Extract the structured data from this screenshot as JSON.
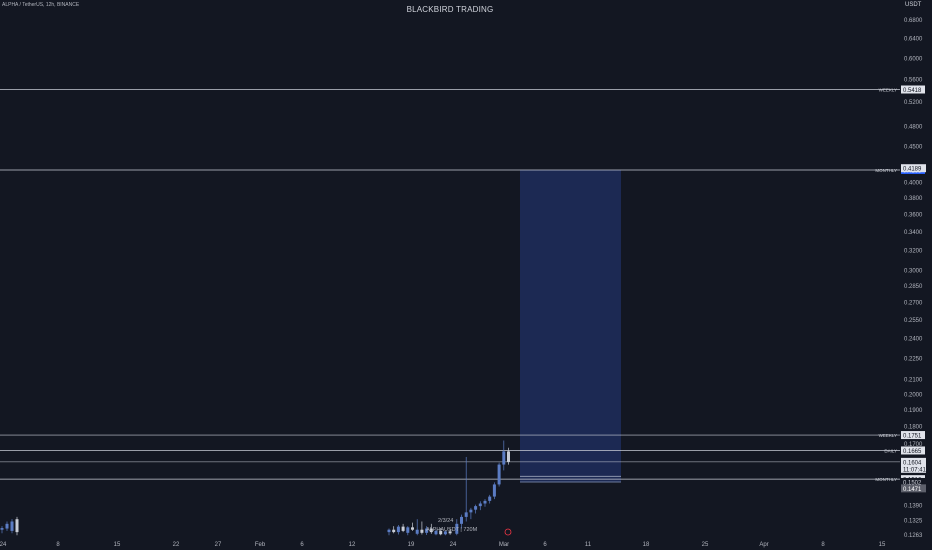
{
  "header": {
    "symbol_info": "ALPHA / TetherUS, 12h, BINANCE",
    "title": "BLACKBIRD TRADING",
    "currency": "USDT"
  },
  "colors": {
    "background": "#131722",
    "grid": "#1e222d",
    "level_line": "#c8ccd6",
    "target_box": "#1e2d5c",
    "candle_up": "#5b7cc4",
    "candle_down": "#c9cdd6"
  },
  "chart_data": {
    "type": "candlestick",
    "price_scale": "log",
    "y_axis_ticks": [
      "0.6800",
      "0.6400",
      "0.6000",
      "0.5600",
      "0.5200",
      "0.4800",
      "0.4500",
      "0.4000",
      "0.3800",
      "0.3600",
      "0.3400",
      "0.3200",
      "0.3000",
      "0.2850",
      "0.2700",
      "0.2550",
      "0.2400",
      "0.2250",
      "0.2100",
      "0.2000",
      "0.1900",
      "0.1800",
      "0.1700",
      "0.1390",
      "0.1325",
      "0.1263"
    ],
    "x_axis_ticks": [
      "24",
      "8",
      "15",
      "22",
      "27",
      "Feb",
      "6",
      "12",
      "19",
      "24",
      "Mar",
      "6",
      "11",
      "18",
      "25",
      "Apr",
      "8",
      "15"
    ],
    "levels": [
      {
        "label": "WEEKLY",
        "price": "0.5418",
        "value": 0.5418,
        "badge": "light"
      },
      {
        "label": "MONTHLY",
        "price": "0.4165",
        "value": 0.4165,
        "badge": "blue"
      },
      {
        "label": "WEEKLY",
        "price": "0.1751",
        "value": 0.1751,
        "badge": "light"
      },
      {
        "label": "DAILY",
        "price": "0.1665",
        "value": 0.1665,
        "badge": "light"
      },
      {
        "label": "MONTHLY",
        "price": "0.1516",
        "value": 0.1516,
        "badge": "light"
      }
    ],
    "price_badges": [
      {
        "text": "0.4189",
        "value": 0.4189,
        "style": "light"
      },
      {
        "text": "0.1604",
        "value": 0.1604,
        "style": "light"
      },
      {
        "text": "11:07:41",
        "value": 0.1568,
        "style": "time"
      },
      {
        "text": "0.1502",
        "value": 0.1502,
        "style": "plain"
      },
      {
        "text": "0.1471",
        "value": 0.1471,
        "style": "dark"
      }
    ],
    "unlabeled_lines": [
      0.1604
    ],
    "target_zone": {
      "top": 0.4165,
      "bottom": 0.1502
    },
    "tooltip": {
      "date": "2/3/24",
      "text": "ALPHAUSDT | 720M"
    },
    "candles": [
      {
        "o": 0.1275,
        "h": 0.129,
        "l": 0.1262,
        "c": 0.1285
      },
      {
        "o": 0.1285,
        "h": 0.13,
        "l": 0.127,
        "c": 0.1275
      },
      {
        "o": 0.1275,
        "h": 0.1305,
        "l": 0.1265,
        "c": 0.1298
      },
      {
        "o": 0.1298,
        "h": 0.131,
        "l": 0.1275,
        "c": 0.128
      },
      {
        "o": 0.1272,
        "h": 0.13,
        "l": 0.1262,
        "c": 0.1295
      },
      {
        "o": 0.1295,
        "h": 0.1315,
        "l": 0.128,
        "c": 0.1285
      },
      {
        "o": 0.1268,
        "h": 0.133,
        "l": 0.1262,
        "c": 0.1285
      },
      {
        "o": 0.1285,
        "h": 0.132,
        "l": 0.1265,
        "c": 0.1272
      },
      {
        "o": 0.1272,
        "h": 0.13,
        "l": 0.1263,
        "c": 0.129
      },
      {
        "o": 0.129,
        "h": 0.131,
        "l": 0.1268,
        "c": 0.1275
      },
      {
        "o": 0.1266,
        "h": 0.1285,
        "l": 0.1262,
        "c": 0.128
      },
      {
        "o": 0.128,
        "h": 0.1292,
        "l": 0.1262,
        "c": 0.1266
      },
      {
        "o": 0.1266,
        "h": 0.1282,
        "l": 0.1262,
        "c": 0.1278
      },
      {
        "o": 0.1278,
        "h": 0.129,
        "l": 0.1264,
        "c": 0.127
      },
      {
        "o": 0.1268,
        "h": 0.133,
        "l": 0.1262,
        "c": 0.131
      },
      {
        "o": 0.131,
        "h": 0.135,
        "l": 0.129,
        "c": 0.134
      },
      {
        "o": 0.134,
        "h": 0.163,
        "l": 0.132,
        "c": 0.136
      },
      {
        "o": 0.136,
        "h": 0.138,
        "l": 0.133,
        "c": 0.1372
      },
      {
        "o": 0.1372,
        "h": 0.1395,
        "l": 0.1355,
        "c": 0.1388
      },
      {
        "o": 0.1388,
        "h": 0.141,
        "l": 0.137,
        "c": 0.14
      },
      {
        "o": 0.14,
        "h": 0.142,
        "l": 0.1385,
        "c": 0.1412
      },
      {
        "o": 0.1412,
        "h": 0.144,
        "l": 0.14,
        "c": 0.1432
      },
      {
        "o": 0.1432,
        "h": 0.15,
        "l": 0.142,
        "c": 0.149
      },
      {
        "o": 0.149,
        "h": 0.16,
        "l": 0.148,
        "c": 0.159
      },
      {
        "o": 0.159,
        "h": 0.172,
        "l": 0.156,
        "c": 0.166
      },
      {
        "o": 0.166,
        "h": 0.168,
        "l": 0.159,
        "c": 0.1604
      }
    ]
  }
}
